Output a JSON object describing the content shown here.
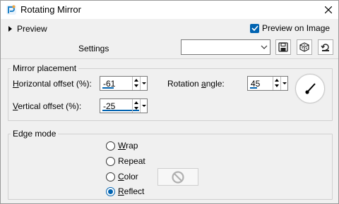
{
  "window": {
    "title": "Rotating Mirror"
  },
  "preview": {
    "label": "Preview",
    "preview_on_image_label": "Preview on Image",
    "preview_on_image_checked": true
  },
  "settings": {
    "label": "Settings",
    "value": ""
  },
  "mirror_placement": {
    "title": "Mirror placement",
    "horizontal_offset": {
      "label_prefix": "H",
      "label_rest": "orizontal offset (%):",
      "value": "-61",
      "level": 0.2
    },
    "vertical_offset": {
      "label_prefix": "V",
      "label_rest": "ertical offset (%):",
      "value": "-25",
      "level": 0.48
    },
    "rotation_angle": {
      "label_start": "Rotation ",
      "label_u": "a",
      "label_end": "ngle:",
      "value": "45",
      "level": 0.12
    }
  },
  "edge_mode": {
    "title": "Edge mode",
    "options": [
      {
        "u": "W",
        "rest": "rap",
        "selected": false
      },
      {
        "u": "",
        "rest": "Repeat",
        "selected": false
      },
      {
        "u": "C",
        "rest": "olor",
        "selected": false
      },
      {
        "u": "R",
        "rest": "eflect",
        "selected": true
      }
    ]
  },
  "colors": {
    "accent": "#0063b1",
    "background": "#f0f0f0"
  },
  "icons": [
    "app-icon",
    "close-icon",
    "save-icon",
    "randomize-icon",
    "reset-icon",
    "dial-icon",
    "no-color-icon"
  ]
}
